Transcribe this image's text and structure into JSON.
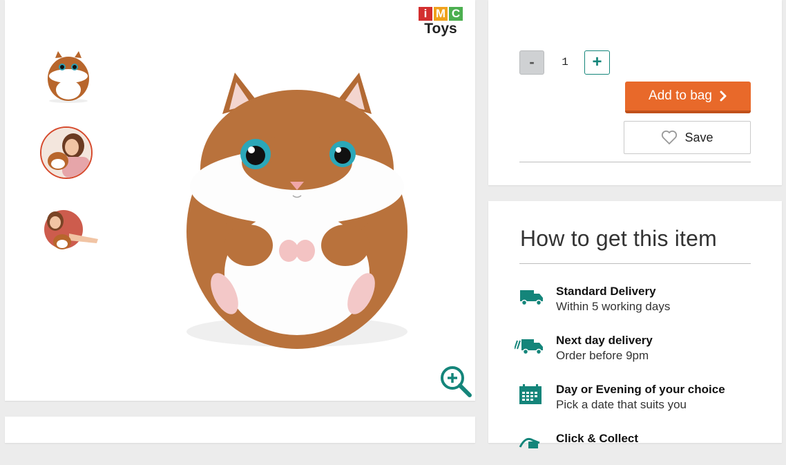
{
  "brand": {
    "letters": [
      "i",
      "M",
      "C"
    ],
    "letter_colors": [
      "#d32f2f",
      "#f0a21c",
      "#4caf50"
    ],
    "name": "Toys"
  },
  "gallery": {
    "thumbnails": [
      {
        "name": "hamster-front-thumbnail"
      },
      {
        "name": "girl-holding-hamster-thumbnail",
        "selected": true
      },
      {
        "name": "girl-playing-hamster-thumbnail"
      }
    ],
    "zoom_icon": "zoom-in-icon"
  },
  "purchase": {
    "quantity": "1",
    "minus_label": "-",
    "plus_label": "+",
    "add_to_bag_label": "Add to bag",
    "save_label": "Save",
    "accent_color": "#e8692a",
    "teal_color": "#14857a"
  },
  "delivery": {
    "title": "How to get this item",
    "options": [
      {
        "icon": "truck-icon",
        "title": "Standard Delivery",
        "subtitle": "Within 5 working days"
      },
      {
        "icon": "fast-truck-icon",
        "title": "Next day delivery",
        "subtitle": "Order before 9pm"
      },
      {
        "icon": "calendar-icon",
        "title": "Day or Evening of your choice",
        "subtitle": "Pick a date that suits you"
      },
      {
        "icon": "click-collect-icon",
        "title": "Click & Collect",
        "subtitle": ""
      }
    ]
  }
}
